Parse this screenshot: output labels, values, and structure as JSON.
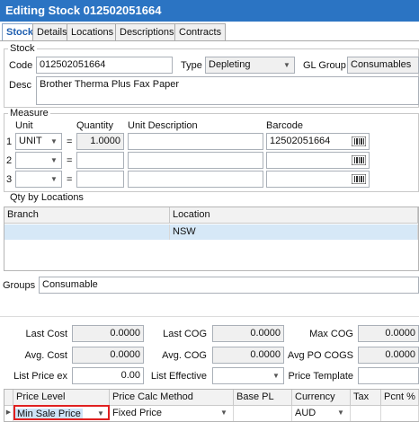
{
  "window": {
    "title": "Editing Stock 012502051664"
  },
  "tabs": [
    "Stock",
    "Details",
    "Locations",
    "Descriptions",
    "Contracts"
  ],
  "stock": {
    "group_label": "Stock",
    "code_label": "Code",
    "code_value": "012502051664",
    "type_label": "Type",
    "type_value": "Depleting",
    "gl_group_label": "GL Group",
    "gl_group_value": "Consumables",
    "desc_label": "Desc",
    "desc_value": "Brother Therma Plus Fax Paper"
  },
  "measure": {
    "group_label": "Measure",
    "unit_header": "Unit",
    "quantity_header": "Quantity",
    "unit_desc_header": "Unit Description",
    "barcode_header": "Barcode",
    "rows": [
      {
        "index": "1",
        "unit": "UNIT",
        "equals": "=",
        "quantity": "1.0000",
        "unit_desc": "",
        "barcode": "12502051664"
      },
      {
        "index": "2",
        "unit": "",
        "equals": "=",
        "quantity": "",
        "unit_desc": "",
        "barcode": ""
      },
      {
        "index": "3",
        "unit": "",
        "equals": "=",
        "quantity": "",
        "unit_desc": "",
        "barcode": ""
      }
    ]
  },
  "qty_locations": {
    "group_label": "Qty by Locations",
    "columns": [
      "Branch",
      "Location"
    ],
    "rows": [
      {
        "branch": "",
        "location": "NSW"
      }
    ]
  },
  "groups": {
    "label": "Groups",
    "value": "Consumable"
  },
  "costs": {
    "last_cost_label": "Last Cost",
    "last_cost": "0.0000",
    "last_cog_label": "Last COG",
    "last_cog": "0.0000",
    "max_cog_label": "Max COG",
    "max_cog": "0.0000",
    "avg_cost_label": "Avg. Cost",
    "avg_cost": "0.0000",
    "avg_cog_label": "Avg. COG",
    "avg_cog": "0.0000",
    "avg_po_cogs_label": "Avg PO COGS",
    "avg_po_cogs": "0.0000",
    "list_price_label": "List Price ex",
    "list_price": "0.00",
    "list_effective_label": "List Effective",
    "list_effective": "",
    "price_template_label": "Price Template",
    "price_template": ""
  },
  "price_grid": {
    "columns": [
      "Price Level",
      "Price Calc Method",
      "Base PL",
      "Currency",
      "Tax",
      "Pcnt %"
    ],
    "rows": [
      {
        "price_level": "Min Sale Price",
        "calc_method": "Fixed Price",
        "base_pl": "",
        "currency": "AUD",
        "tax": "",
        "pcnt": ""
      }
    ]
  },
  "colors": {
    "title_bar": "#2b74c3",
    "highlight_border": "#e02020",
    "selection": "#d6e8f7"
  },
  "icons": {
    "dropdown": "chevron-down-icon",
    "barcode": "barcode-icon",
    "row_indicator": "row-pointer-icon"
  }
}
